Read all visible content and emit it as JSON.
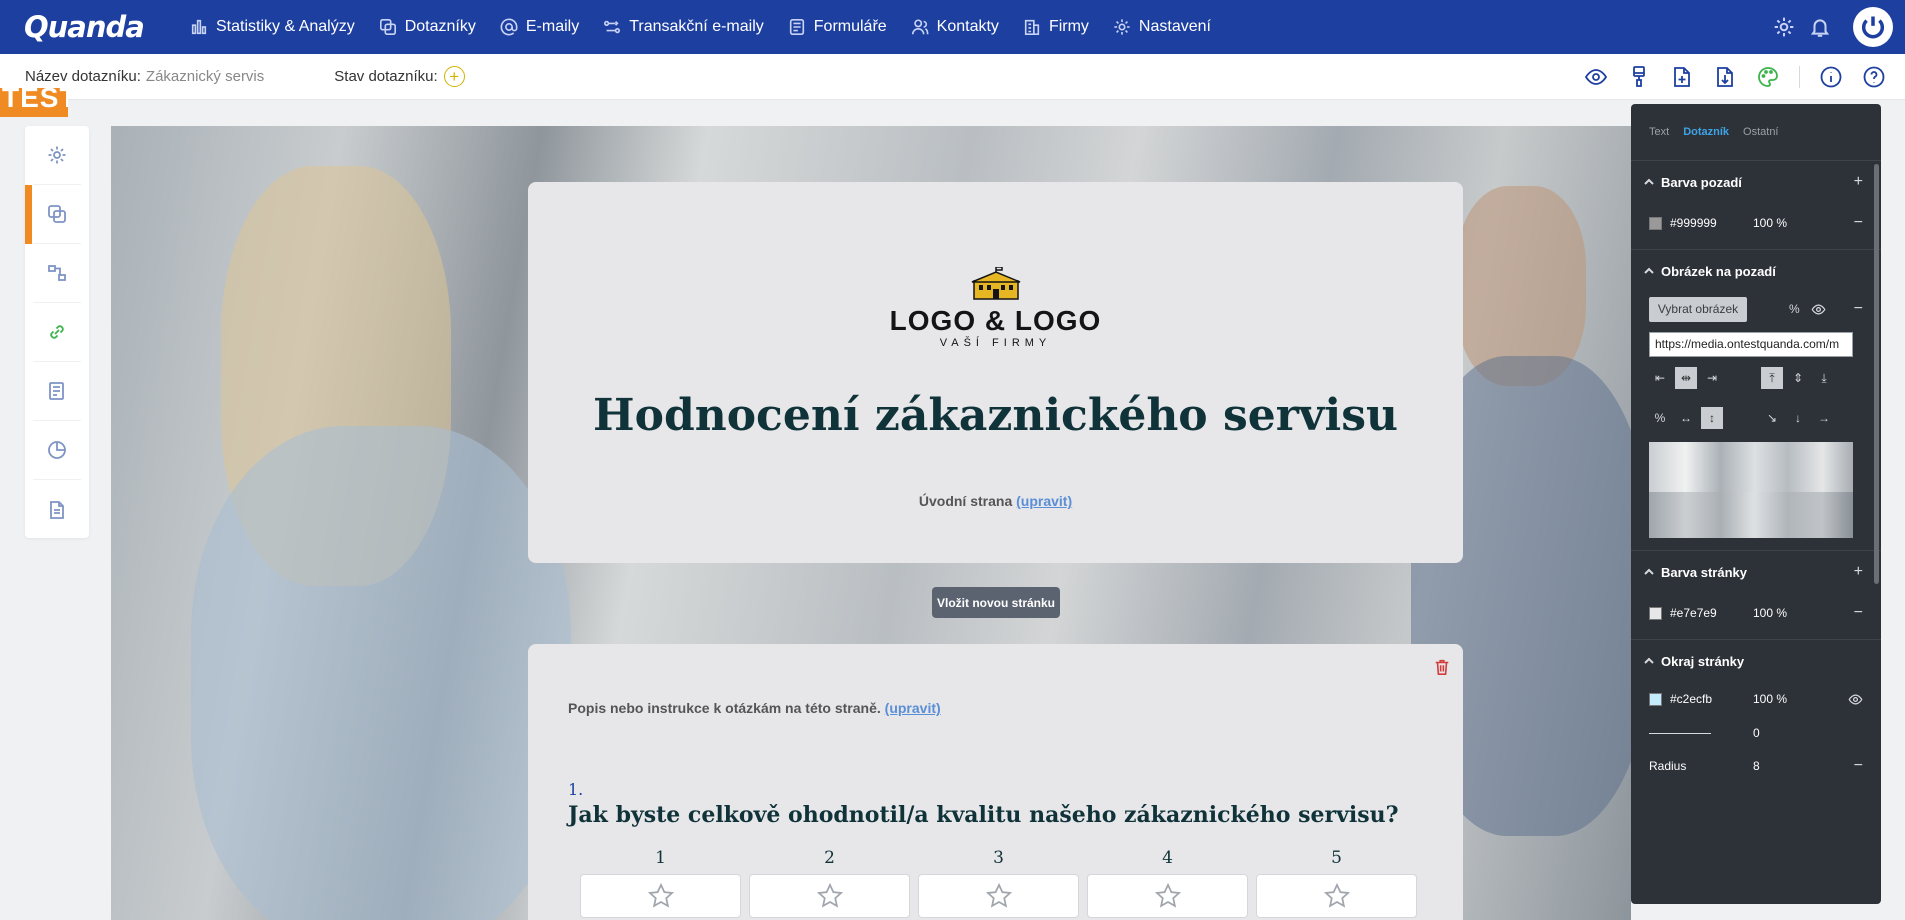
{
  "app": {
    "logo": "Quanda"
  },
  "nav": {
    "items": [
      {
        "label": "Statistiky & Analýzy",
        "icon": "bar-chart-icon"
      },
      {
        "label": "Dotazníky",
        "icon": "survey-icon"
      },
      {
        "label": "E-maily",
        "icon": "at-icon"
      },
      {
        "label": "Transakční e-maily",
        "icon": "flow-icon"
      },
      {
        "label": "Formuláře",
        "icon": "form-icon"
      },
      {
        "label": "Kontakty",
        "icon": "contacts-icon"
      },
      {
        "label": "Firmy",
        "icon": "building-icon"
      },
      {
        "label": "Nastavení",
        "icon": "gear-icon"
      }
    ]
  },
  "subbar": {
    "name_label": "Název dotazníku:",
    "name_value": "Zákaznický servis",
    "state_label": "Stav dotazníku:",
    "state_icon": "+"
  },
  "test_tag": "TEST",
  "survey": {
    "brand_name": "LOGO & LOGO",
    "brand_sub": "VAŠÍ FIRMY",
    "title": "Hodnocení zákaznického servisu",
    "intro_text": "Úvodní strana",
    "intro_link": "(upravit)",
    "insert_page": "Vložit novou stránku",
    "page_desc": "Popis nebo instrukce k otázkám na této straně.",
    "page_desc_link": "(upravit)",
    "question_number": "1.",
    "question_text": "Jak byste celkově ohodnotil/a kvalitu našeho zákaznického servisu?",
    "scale": [
      "1",
      "2",
      "3",
      "4",
      "5"
    ]
  },
  "panel": {
    "tabs": [
      "Text",
      "Dotazník",
      "Ostatní"
    ],
    "active_tab": "Dotazník",
    "bg_color": {
      "title": "Barva pozadí",
      "value": "#999999",
      "percent": "100 %"
    },
    "bg_image": {
      "title": "Obrázek na pozadí",
      "pick": "Vybrat obrázek",
      "percent": "%",
      "url": "https://media.ontestquanda.com/m"
    },
    "page_color": {
      "title": "Barva stránky",
      "value": "#e7e7e9",
      "percent": "100 %"
    },
    "page_border": {
      "title": "Okraj stránky",
      "value": "#c2ecfb",
      "percent": "100 %",
      "width": "0",
      "radius_label": "Radius",
      "radius": "8"
    }
  },
  "colors": {
    "nav": "#1d3fa0",
    "accent": "#f08a22",
    "page": "#e7e7e9",
    "border_swatch": "#c2ecfb",
    "bg_swatch": "#999999"
  }
}
